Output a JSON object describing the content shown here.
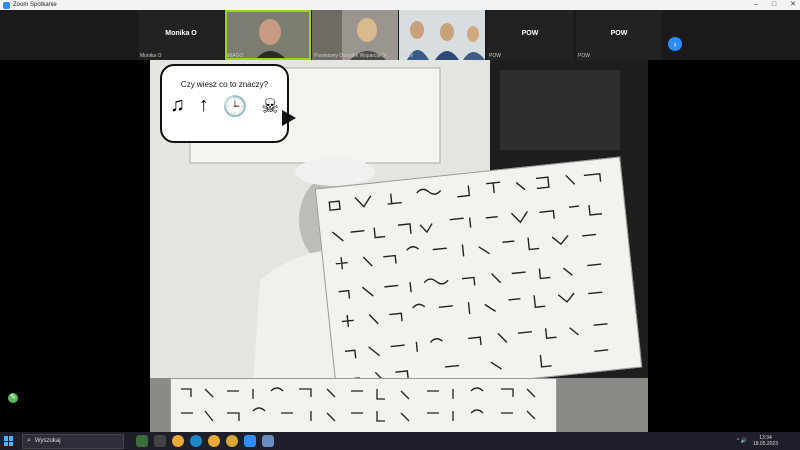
{
  "window": {
    "title": "Zoom Spotkanie",
    "controls": [
      "–",
      "□",
      "✕"
    ]
  },
  "participants": [
    {
      "center_name": "Monika O",
      "corner_name": "Monika O"
    },
    {
      "center_name": "",
      "corner_name": "iMAGO"
    },
    {
      "center_name": "",
      "corner_name": "Powiatowy Ośrodek Wsparcia \"P..."
    },
    {
      "center_name": "",
      "corner_name": "POW"
    },
    {
      "center_name": "POW",
      "corner_name": "POW"
    },
    {
      "center_name": "POW",
      "corner_name": "POW"
    }
  ],
  "strip": {
    "next_icon": "›"
  },
  "slide": {
    "question": "Czy wiesz co to znaczy?",
    "icons": [
      "♫",
      "↑",
      "🕒",
      "☠"
    ],
    "icon_names": [
      "music-note-icon",
      "arrow-up-icon",
      "clock-icon",
      "skull-crossbones-icon"
    ]
  },
  "taskbar": {
    "search_placeholder": "Wyszukaj",
    "time": "13:34",
    "date": "18.05.2023",
    "tray_glyphs": "^ 🔊"
  },
  "colors": {
    "zoom_blue": "#2d8cff",
    "active_speaker": "#9ad41c",
    "taskbar": "#1f1f2b"
  }
}
